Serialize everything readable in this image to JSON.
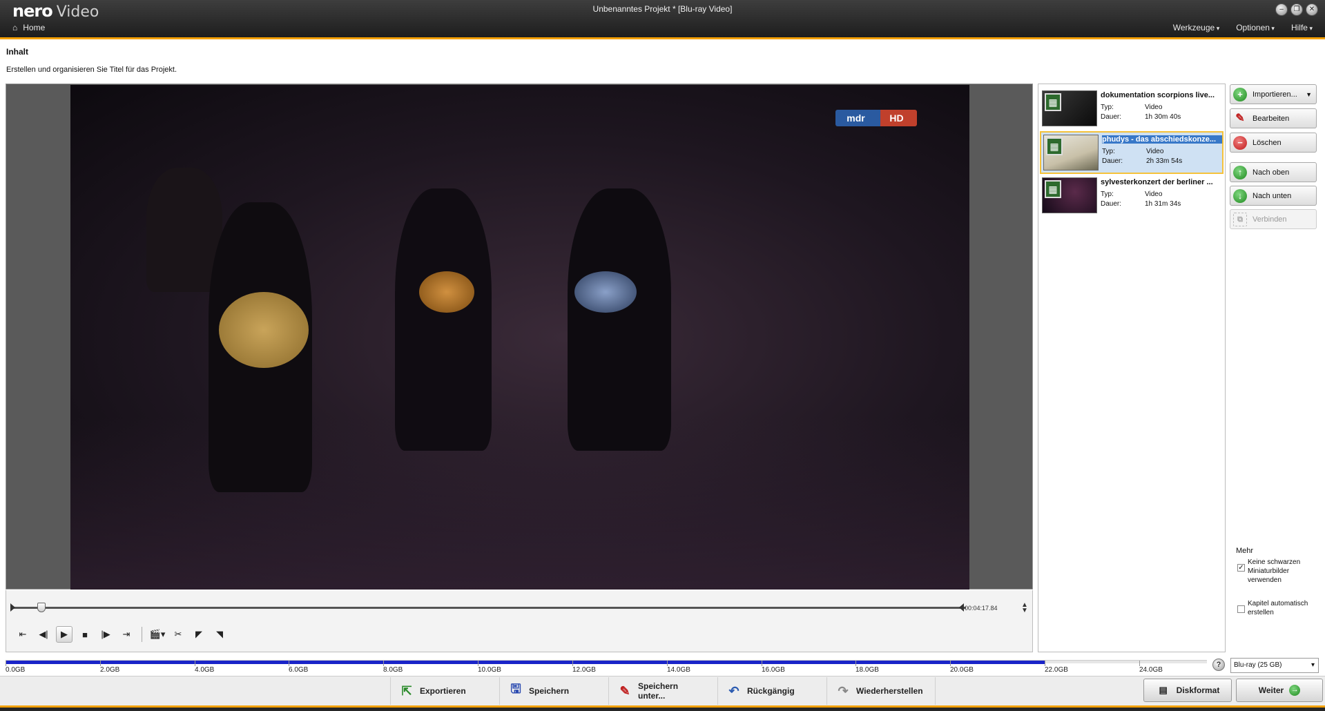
{
  "app": {
    "brand": "nero",
    "product": "Video",
    "window_title": "Unbenanntes Projekt * [Blu-ray Video]"
  },
  "nav": {
    "home": "Home",
    "menus": [
      "Werkzeuge",
      "Optionen",
      "Hilfe"
    ]
  },
  "section": {
    "title": "Inhalt",
    "subtitle": "Erstellen und organisieren Sie Titel für das Projekt."
  },
  "video": {
    "channel_logo": "mdr",
    "channel_hd": "HD",
    "timecode": "00:04:17.84",
    "position_fraction": 0.03
  },
  "titles": [
    {
      "name": "dokumentation scorpions live...",
      "type_label": "Typ:",
      "type": "Video",
      "duration_label": "Dauer:",
      "duration": "1h 30m 40s",
      "selected": false
    },
    {
      "name": "phudys - das abschiedskonze...",
      "type_label": "Typ:",
      "type": "Video",
      "duration_label": "Dauer:",
      "duration": "2h 33m 54s",
      "selected": true
    },
    {
      "name": "sylvesterkonzert der berliner ...",
      "type_label": "Typ:",
      "type": "Video",
      "duration_label": "Dauer:",
      "duration": "1h 31m 34s",
      "selected": false
    }
  ],
  "actions": {
    "import": "Importieren...",
    "edit": "Bearbeiten",
    "delete": "Löschen",
    "up": "Nach oben",
    "down": "Nach unten",
    "join": "Verbinden"
  },
  "more": {
    "title": "Mehr",
    "no_black_thumbs": "Keine schwarzen Miniaturbilder verwenden",
    "no_black_thumbs_checked": true,
    "auto_chapters": "Kapitel automatisch erstellen",
    "auto_chapters_checked": false
  },
  "capacity": {
    "ticks": [
      "0.0GB",
      "2.0GB",
      "4.0GB",
      "6.0GB",
      "8.0GB",
      "10.0GB",
      "12.0GB",
      "14.0GB",
      "16.0GB",
      "18.0GB",
      "20.0GB",
      "22.0GB",
      "24.0GB"
    ],
    "used_gb": 22.0,
    "disc_type": "Blu-ray (25 GB)"
  },
  "bottom": {
    "export": "Exportieren",
    "save": "Speichern",
    "save_as": "Speichern unter...",
    "undo": "Rückgängig",
    "redo": "Wiederherstellen",
    "disc_format": "Diskformat",
    "next": "Weiter"
  },
  "colors": {
    "accent": "#f3a000",
    "capacity_fill": "#1a24c8",
    "selection": "#cfe1f3"
  }
}
